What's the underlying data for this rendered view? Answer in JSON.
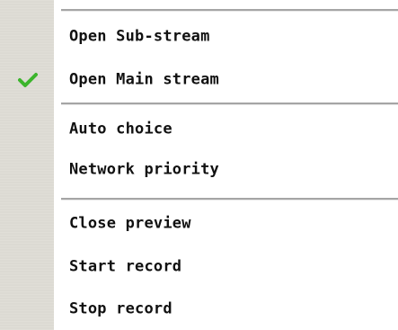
{
  "menu": {
    "items": [
      {
        "label": "Open Sub-stream",
        "checked": false
      },
      {
        "label": "Open Main stream",
        "checked": true,
        "check_icon": "checkmark-icon"
      },
      {
        "label": "Auto choice",
        "checked": false
      },
      {
        "label": "Network priority",
        "checked": false
      },
      {
        "label": "Close preview",
        "checked": false
      },
      {
        "label": "Start record",
        "checked": false
      },
      {
        "label": "Stop record",
        "checked": false
      }
    ]
  },
  "colors": {
    "check": "#3cb52c",
    "gutter": "#dcdad3",
    "separator": "#a5a5a5"
  }
}
